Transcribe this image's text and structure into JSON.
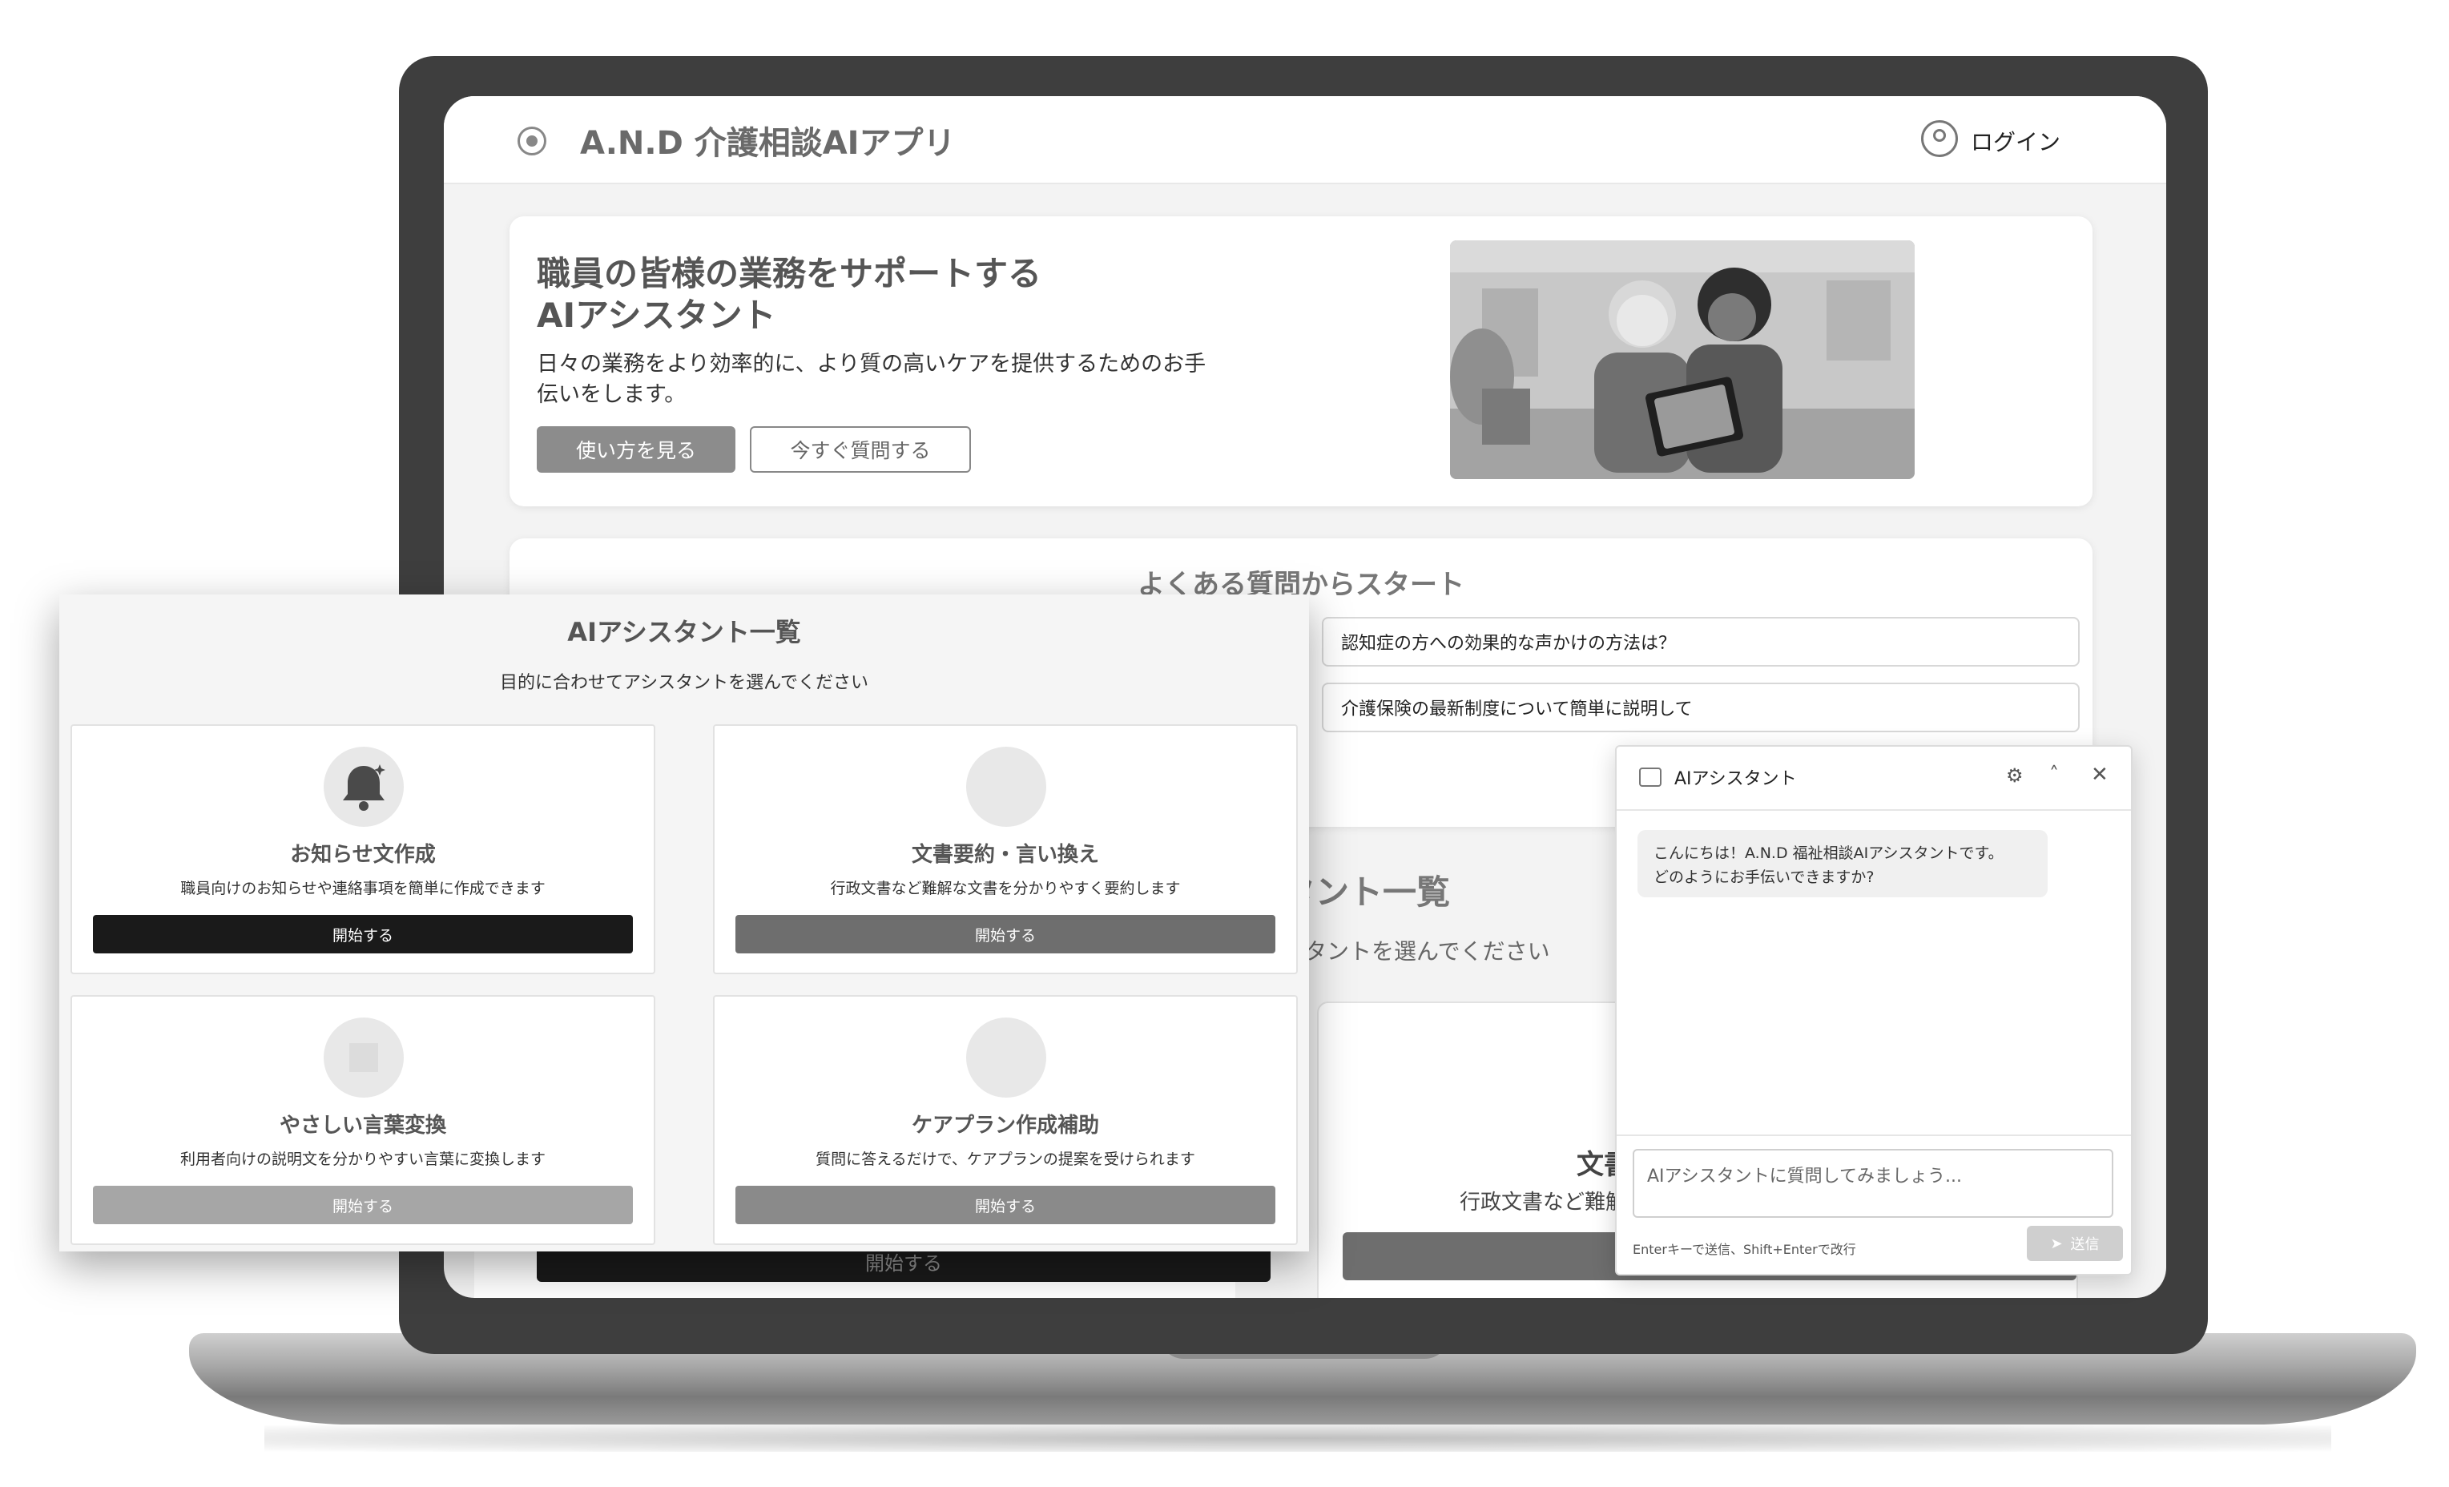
{
  "app": {
    "title": "A.N.D 介護相談AIアプリ",
    "login_label": "ログイン"
  },
  "hero": {
    "title_line1": "職員の皆様の業務をサポートする",
    "title_line2": "AIアシスタント",
    "desc_line1": "日々の業務をより効率的に、より質の高いケアを提供するためのお手",
    "desc_line2": "伝いをします。",
    "primary_button": "使い方を見る",
    "secondary_button": "今すぐ質問する"
  },
  "faq": {
    "title": "よくある質問からスタート",
    "items": [
      "認知症の方への効果的な声かけの方法は？",
      "介護保険の最新制度について簡単に説明して"
    ]
  },
  "background_section": {
    "title_fragment": "タント一覧",
    "subtitle_fragment": "スタントを選んでください",
    "card_title_fragment": "文書",
    "card_desc_fragment": "行政文書など難解",
    "start_fragment": "開始する"
  },
  "assistant_list": {
    "title": "AIアシスタント一覧",
    "subtitle": "目的に合わせてアシスタントを選んでください",
    "cards": [
      {
        "title": "お知らせ文作成",
        "desc": "職員向けのお知らせや連絡事項を簡単に作成できます",
        "button": "開始する",
        "icon": "bell-icon",
        "button_color": "#1a1a1a"
      },
      {
        "title": "文書要約・言い換え",
        "desc": "行政文書など難解な文書を分かりやすく要約します",
        "button": "開始する",
        "icon": "document-icon",
        "button_color": "#6e6e6e"
      },
      {
        "title": "やさしい言葉変換",
        "desc": "利用者向けの説明文を分かりやすい言葉に変換します",
        "button": "開始する",
        "icon": "translate-icon",
        "button_color": "#a6a6a6"
      },
      {
        "title": "ケアプラン作成補助",
        "desc": "質問に答えるだけで、ケアプランの提案を受けられます",
        "button": "開始する",
        "icon": "clipboard-icon",
        "button_color": "#8a8a8a"
      }
    ]
  },
  "chat": {
    "title": "AIアシスタント",
    "greeting_line1": "こんにちは！A.N.D 福祉相談AIアシスタントです。",
    "greeting_line2": "どのようにお手伝いできますか?",
    "input_placeholder": "AIアシスタントに質問してみましょう...",
    "hint": "Enterキーで送信、Shift+Enterで改行",
    "send_label": "送信"
  }
}
